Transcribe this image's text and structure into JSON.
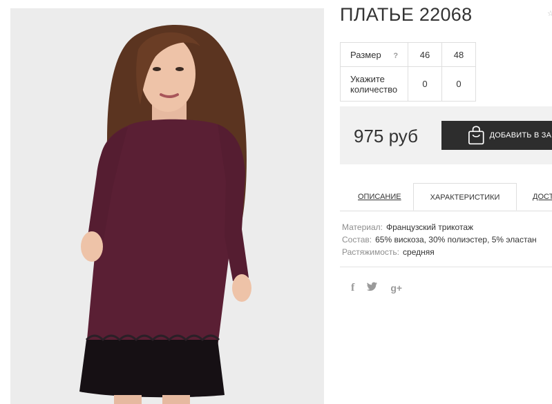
{
  "product": {
    "title": "ПЛАТЬЕ 22068"
  },
  "size_table": {
    "size_label": "Размер",
    "help_mark": "?",
    "sizes": [
      "46",
      "48"
    ],
    "qty_label_line1": "Укажите",
    "qty_label_line2": "количество",
    "quantities": [
      "0",
      "0"
    ]
  },
  "purchase": {
    "price": "975 руб",
    "add_to_cart_label": "ДОБАВИТЬ В ЗАКАЗ",
    "bag_icon": "shopping-bag-icon"
  },
  "tabs": [
    {
      "label": "ОПИСАНИЕ",
      "active": false
    },
    {
      "label": "ХАРАКТЕРИСТИКИ",
      "active": true
    },
    {
      "label": "ДОСТАВКА",
      "active": false
    }
  ],
  "specs": [
    {
      "key": "Материал:",
      "value": "Французский трикотаж"
    },
    {
      "key": "Состав:",
      "value": "65% вискоза, 30% полиэстер, 5% эластан"
    },
    {
      "key": "Растяжимость:",
      "value": "средняя"
    }
  ],
  "social": [
    {
      "icon": "facebook-icon",
      "glyph": "f"
    },
    {
      "icon": "twitter-icon",
      "glyph": "🐦"
    },
    {
      "icon": "google-plus-icon",
      "glyph": "g+"
    }
  ],
  "colors": {
    "dress": "#5a1f34",
    "button": "#2d2d2d",
    "price_box_bg": "#f1f1f1",
    "photo_bg": "#ececec"
  }
}
